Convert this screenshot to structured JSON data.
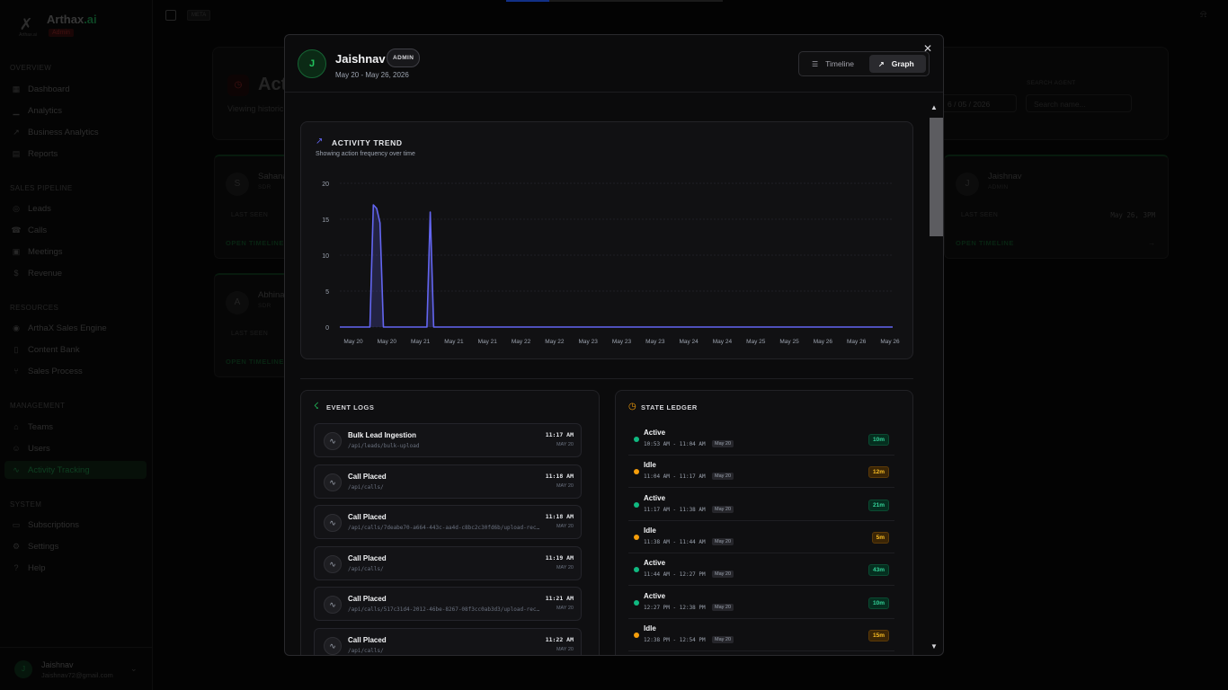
{
  "sidebar": {
    "brand_name": "Arthax",
    "brand_ai": ".ai",
    "brand_badge": "Admin",
    "logo_text": "Arthax.ai",
    "sections": [
      "OVERVIEW",
      "SALES PIPELINE",
      "RESOURCES",
      "MANAGEMENT",
      "SYSTEM"
    ],
    "items": [
      {
        "label": "Dashboard",
        "icon": "grid-icon"
      },
      {
        "label": "Analytics",
        "icon": "chart-icon"
      },
      {
        "label": "Business Analytics",
        "icon": "trend-icon"
      },
      {
        "label": "Reports",
        "icon": "file-icon"
      },
      {
        "label": "Leads",
        "icon": "globe-icon"
      },
      {
        "label": "Calls",
        "icon": "phone-icon"
      },
      {
        "label": "Meetings",
        "icon": "calendar-icon"
      },
      {
        "label": "Revenue",
        "icon": "dollar-icon"
      },
      {
        "label": "ArthaX Sales Engine",
        "icon": "engine-icon"
      },
      {
        "label": "Content Bank",
        "icon": "book-icon"
      },
      {
        "label": "Sales Process",
        "icon": "branch-icon"
      },
      {
        "label": "Teams",
        "icon": "team-icon"
      },
      {
        "label": "Users",
        "icon": "users-icon"
      },
      {
        "label": "Activity Tracking",
        "icon": "activity-icon"
      },
      {
        "label": "Subscriptions",
        "icon": "card-icon"
      },
      {
        "label": "Settings",
        "icon": "gear-icon"
      },
      {
        "label": "Help",
        "icon": "help-icon"
      }
    ],
    "user": {
      "initial": "J",
      "name": "Jaishnav",
      "email": "Jaishnav72@gmail.com"
    }
  },
  "topbar": {
    "chip": "META"
  },
  "page": {
    "title": "Act",
    "subtitle": "Viewing historic",
    "date_value": "6 / 05 / 2026",
    "search_label": "SEARCH AGENT",
    "search_placeholder": "Search name...",
    "agents": [
      {
        "initial": "S",
        "name": "Sahana",
        "role": "SDR",
        "seen_label": "LAST SEEN",
        "seen_value": "",
        "open": "OPEN TIMELINE"
      },
      {
        "initial": "J",
        "name": "Jaishnav",
        "role": "ADMIN",
        "seen_label": "LAST SEEN",
        "seen_value": "May 26, 3PM",
        "open": "OPEN TIMELINE"
      },
      {
        "initial": "A",
        "name": "Abhina",
        "role": "SDR",
        "seen_label": "LAST SEEN",
        "seen_value": "",
        "open": "OPEN TIMELINE"
      }
    ]
  },
  "modal": {
    "initial": "J",
    "name": "Jaishnav",
    "badge": "ADMIN",
    "range": "May 20 - May 26, 2026",
    "tabs": {
      "timeline": "Timeline",
      "graph": "Graph"
    },
    "trend": {
      "title": "ACTIVITY TREND",
      "subtitle": "Showing action frequency over time"
    },
    "event_logs_title": "EVENT LOGS",
    "state_ledger_title": "STATE LEDGER",
    "event_logs": [
      {
        "title": "Bulk Lead Ingestion",
        "path": "/api/leads/bulk-upload",
        "time": "11:17 AM",
        "date": "MAY 20"
      },
      {
        "title": "Call Placed",
        "path": "/api/calls/",
        "time": "11:18 AM",
        "date": "MAY 20"
      },
      {
        "title": "Call Placed",
        "path": "/api/calls/7deabe70-a664-443c-aa4d-c8bc2c30fd6b/upload-recording",
        "time": "11:18 AM",
        "date": "MAY 20"
      },
      {
        "title": "Call Placed",
        "path": "/api/calls/",
        "time": "11:19 AM",
        "date": "MAY 20"
      },
      {
        "title": "Call Placed",
        "path": "/api/calls/517c31d4-2012-46be-8267-08f3cc0ab3d3/upload-recording",
        "time": "11:21 AM",
        "date": "MAY 20"
      },
      {
        "title": "Call Placed",
        "path": "/api/calls/",
        "time": "11:22 AM",
        "date": "MAY 20"
      }
    ],
    "state_ledger": [
      {
        "state": "Active",
        "kind": "active",
        "time": "10:53 AM - 11:04 AM",
        "date": "May 20",
        "duration": "10m"
      },
      {
        "state": "Idle",
        "kind": "idle",
        "time": "11:04 AM - 11:17 AM",
        "date": "May 20",
        "duration": "12m"
      },
      {
        "state": "Active",
        "kind": "active",
        "time": "11:17 AM - 11:38 AM",
        "date": "May 20",
        "duration": "21m"
      },
      {
        "state": "Idle",
        "kind": "idle",
        "time": "11:38 AM - 11:44 AM",
        "date": "May 20",
        "duration": "5m"
      },
      {
        "state": "Active",
        "kind": "active",
        "time": "11:44 AM - 12:27 PM",
        "date": "May 20",
        "duration": "43m"
      },
      {
        "state": "Active",
        "kind": "active",
        "time": "12:27 PM - 12:38 PM",
        "date": "May 20",
        "duration": "10m"
      },
      {
        "state": "Idle",
        "kind": "idle",
        "time": "12:38 PM - 12:54 PM",
        "date": "May 20",
        "duration": "15m"
      }
    ]
  },
  "colors": {
    "accent": "#6366f1",
    "active": "#10b981",
    "idle": "#f59e0b",
    "brand_green": "#22c55e"
  },
  "chart_data": {
    "type": "area",
    "title": "ACTIVITY TREND",
    "subtitle": "Showing action frequency over time",
    "xlabel": "",
    "ylabel": "",
    "ylim": [
      0,
      20
    ],
    "yticks": [
      0,
      5,
      10,
      15,
      20
    ],
    "grid": true,
    "categories": [
      "May 20",
      "May 20",
      "May 21",
      "May 21",
      "May 21",
      "May 22",
      "May 22",
      "May 23",
      "May 23",
      "May 23",
      "May 24",
      "May 24",
      "May 25",
      "May 25",
      "May 26",
      "May 26",
      "May 26"
    ],
    "series": [
      {
        "values": [
          0,
          0,
          0,
          0,
          0,
          0,
          0,
          0,
          0,
          0,
          17,
          16.5,
          14.5,
          0,
          0,
          0,
          0,
          0,
          0,
          0,
          0,
          0,
          0,
          0,
          0,
          0,
          0,
          16,
          0,
          0,
          0,
          0,
          0,
          0,
          0,
          0,
          0,
          0,
          0,
          0,
          0,
          0,
          0,
          0,
          0,
          0,
          0,
          0,
          0,
          0,
          0,
          0,
          0,
          0,
          0,
          0,
          0,
          0,
          0,
          0,
          0,
          0,
          0,
          0,
          0,
          0,
          0,
          0,
          0,
          0,
          0,
          0,
          0,
          0,
          0,
          0,
          0,
          0,
          0,
          0,
          0,
          0,
          0,
          0,
          0,
          0,
          0,
          0,
          0,
          0,
          0,
          0,
          0,
          0,
          0,
          0,
          0,
          0,
          0,
          0,
          0,
          0,
          0,
          0,
          0,
          0,
          0,
          0,
          0,
          0,
          0,
          0,
          0,
          0,
          0,
          0,
          0,
          0,
          0,
          0,
          0,
          0,
          0,
          0,
          0,
          0,
          0,
          0,
          0,
          0,
          0,
          0,
          0,
          0,
          0,
          0,
          0,
          0,
          0,
          0,
          0,
          0,
          0,
          0,
          0,
          0,
          0,
          0,
          0,
          0,
          0,
          0,
          0,
          0,
          0,
          0,
          0,
          0,
          0,
          0,
          0,
          0,
          0,
          0,
          0,
          0
        ]
      }
    ]
  }
}
